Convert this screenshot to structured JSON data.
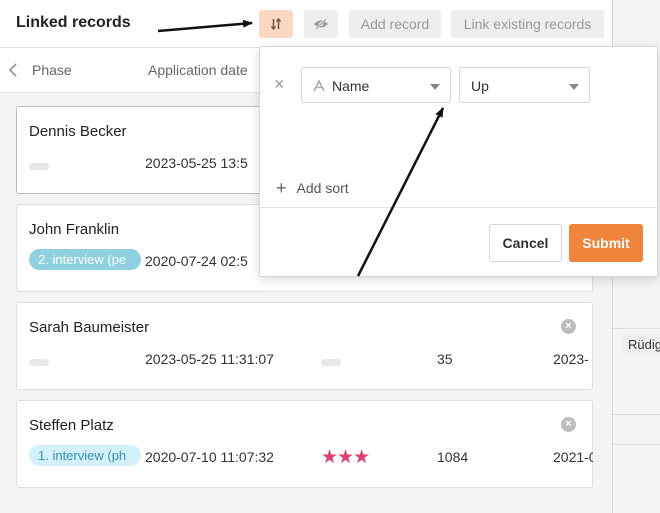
{
  "header": {
    "title": "Linked records",
    "add_record_label": "Add record",
    "link_existing_label": "Link existing records"
  },
  "columns": {
    "phase": "Phase",
    "application_date": "Application date"
  },
  "records": [
    {
      "name": "Dennis Becker",
      "date": "2023-05-25 13:5"
    },
    {
      "name": "John Franklin",
      "tag": "2. interview (pe",
      "date": "2020-07-24 02:5"
    },
    {
      "name": "Sarah Baumeister",
      "date": "2023-05-25 11:31:07",
      "number": "35",
      "date2": "2023-"
    },
    {
      "name": "Steffen Platz",
      "tag": "1. interview (ph",
      "date": "2020-07-10 11:07:32",
      "rating": 3,
      "number": "1084",
      "date2": "2021-0"
    }
  ],
  "sort_popup": {
    "field_label": "Name",
    "direction_label": "Up",
    "add_sort_label": "Add sort",
    "cancel_label": "Cancel",
    "submit_label": "Submit"
  },
  "background": {
    "chip": "Rüdig"
  },
  "colors": {
    "accent": "#f0843a",
    "sort_button_bg": "#fbd8bf",
    "tag_interview2": "#8fd1e0",
    "tag_interview1": "#d3f1f9",
    "star": "#e0416a"
  },
  "icons": {
    "sort": "sort-arrows-icon",
    "hide": "eye-off-icon",
    "back": "chevron-left-icon",
    "remove": "x-circle-icon",
    "field_type": "text-type-icon"
  }
}
